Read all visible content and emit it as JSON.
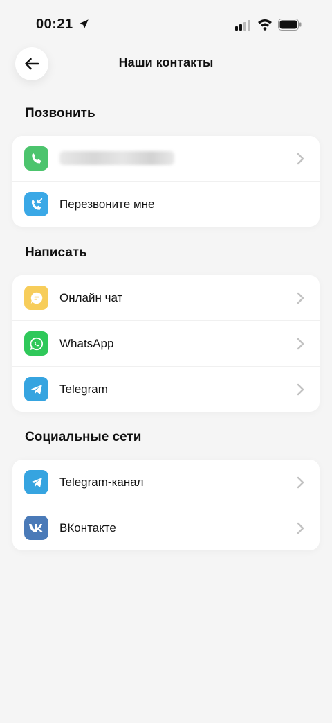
{
  "status": {
    "time": "00:21"
  },
  "header": {
    "title": "Наши контакты"
  },
  "sections": [
    {
      "title": "Позвонить",
      "items": [
        {
          "label": "",
          "icon": "phone-icon",
          "color": "#4CC46D"
        },
        {
          "label": "Перезвоните мне",
          "icon": "callback-icon",
          "color": "#3AA8E6"
        }
      ]
    },
    {
      "title": "Написать",
      "items": [
        {
          "label": "Онлайн чат",
          "icon": "chat-icon",
          "color": "#F7CD5A"
        },
        {
          "label": "WhatsApp",
          "icon": "whatsapp-icon",
          "color": "#2FC85A"
        },
        {
          "label": "Telegram",
          "icon": "telegram-icon",
          "color": "#36A4E0"
        }
      ]
    },
    {
      "title": "Социальные сети",
      "items": [
        {
          "label": "Telegram-канал",
          "icon": "telegram-icon",
          "color": "#36A4E0"
        },
        {
          "label": "ВКонтакте",
          "icon": "vk-icon",
          "color": "#4A7AB8"
        }
      ]
    }
  ]
}
